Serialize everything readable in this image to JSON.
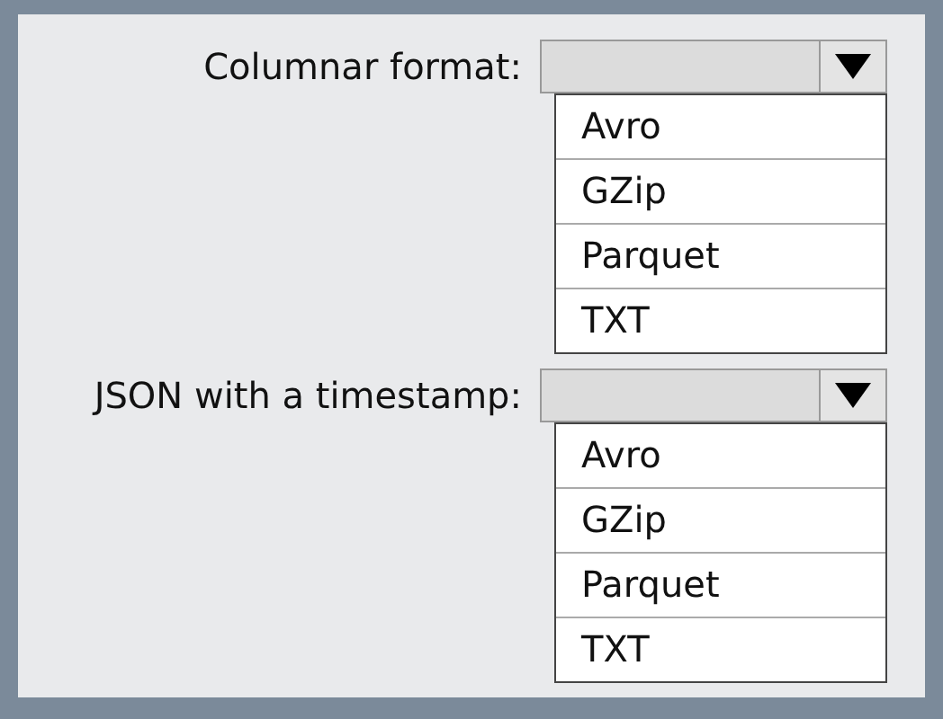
{
  "answers": [
    {
      "label": "Columnar format:",
      "options": [
        "Avro",
        "GZip",
        "Parquet",
        "TXT"
      ]
    },
    {
      "label": "JSON with a timestamp:",
      "options": [
        "Avro",
        "GZip",
        "Parquet",
        "TXT"
      ]
    }
  ]
}
